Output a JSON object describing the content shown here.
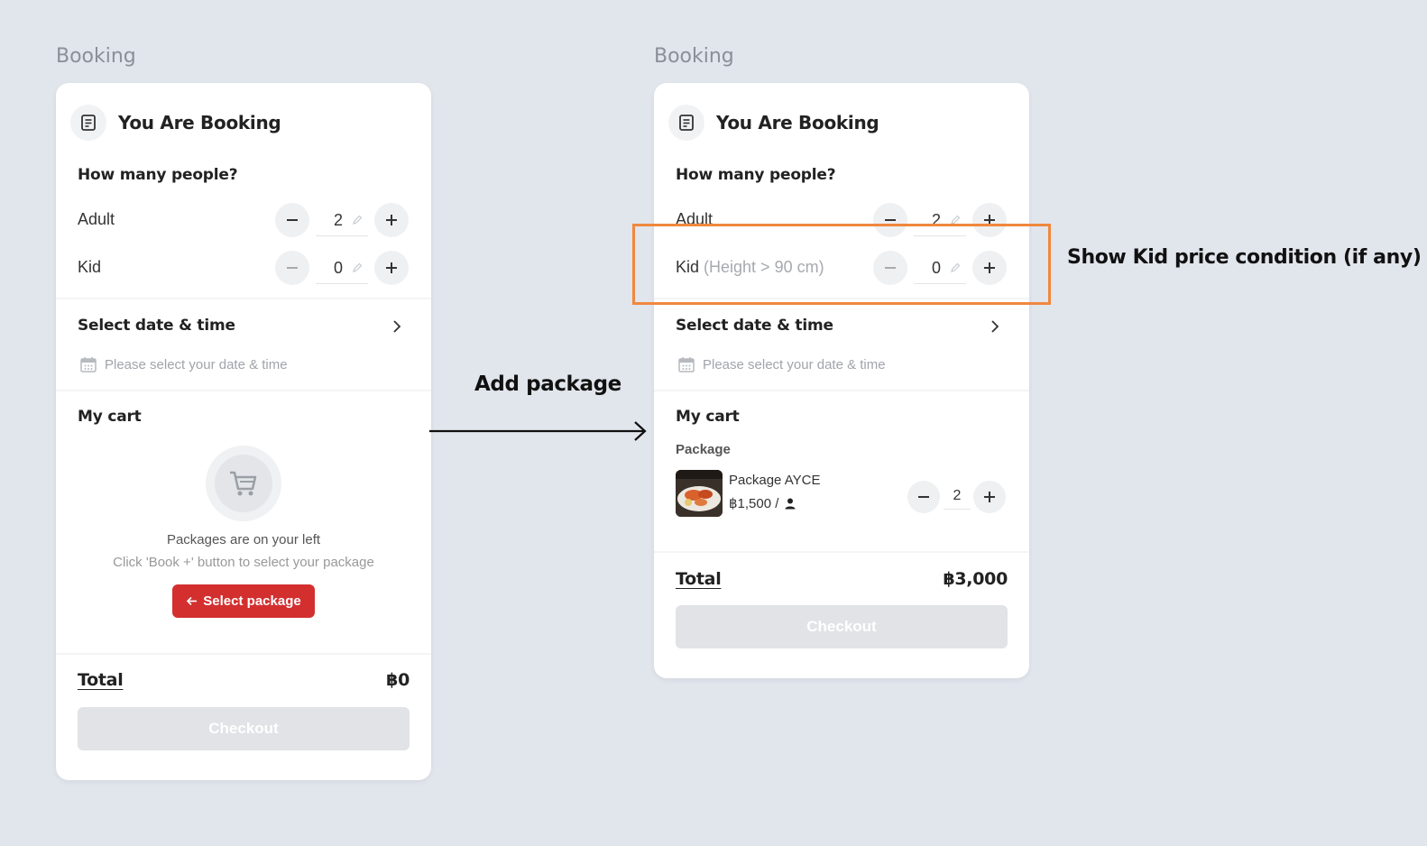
{
  "frames": [
    {
      "label": "Booking",
      "header_title": "You Are Booking",
      "people_title": "How many people?",
      "adult_label": "Adult",
      "adult_value": "2",
      "kid_label": "Kid",
      "kid_condition": "",
      "kid_value": "0",
      "date_title": "Select date & time",
      "date_placeholder": "Please select your date & time",
      "cart_title": "My cart",
      "empty_msg1": "Packages are on your left",
      "empty_msg2": "Click 'Book +' button to select your package",
      "select_button": "Select package",
      "total_label": "Total",
      "total_value": "฿0",
      "checkout_label": "Checkout"
    },
    {
      "label": "Booking",
      "header_title": "You Are Booking",
      "people_title": "How many people?",
      "adult_label": "Adult",
      "adult_value": "2",
      "kid_label": "Kid",
      "kid_condition": "(Height > 90 cm)",
      "kid_value": "0",
      "date_title": "Select date & time",
      "date_placeholder": "Please select your date & time",
      "cart_title": "My cart",
      "package_section": "Package",
      "package_name": "Package AYCE",
      "package_price": "฿1,500 /",
      "package_qty": "2",
      "total_label": "Total",
      "total_value": "฿3,000",
      "checkout_label": "Checkout"
    }
  ],
  "arrow_label": "Add package",
  "annotation_note": "Show Kid price condition (if any)",
  "colors": {
    "background": "#e1e5ec",
    "accent_red": "#d32f2f",
    "highlight_orange": "#f0883e",
    "checkout_disabled": "#e1e3e6"
  },
  "icons": [
    "document-icon",
    "minus-icon",
    "plus-icon",
    "pencil-icon",
    "chevron-right-icon",
    "calendar-icon",
    "cart-icon",
    "arrow-left-icon",
    "user-icon",
    "arrow-right-icon"
  ]
}
